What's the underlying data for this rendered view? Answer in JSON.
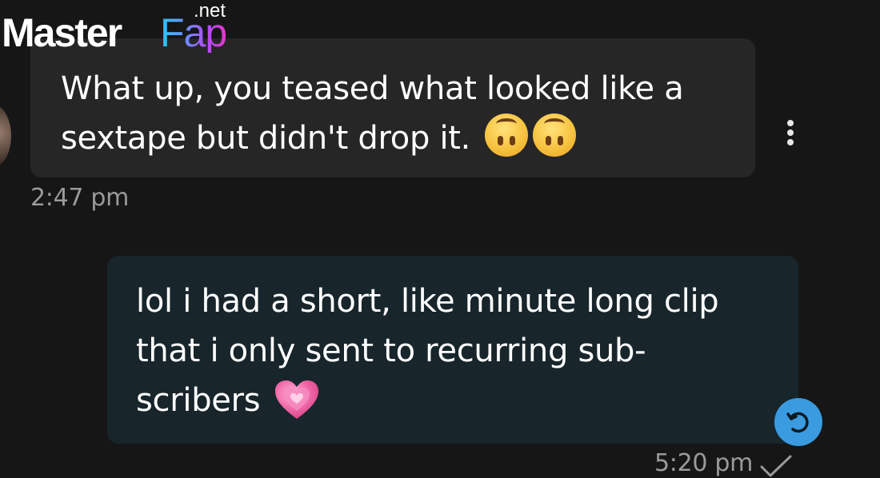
{
  "watermark": {
    "brand_master": "Master",
    "brand_fap": "Fap",
    "brand_tld": ".net"
  },
  "conversation": {
    "incoming": {
      "line1": "What up, you teased what looked like a",
      "line2": "sextape but didn't drop it.",
      "emojis": [
        "upside-down-face",
        "upside-down-face"
      ],
      "timestamp": "2:47 pm",
      "menu_icon": "more-vertical-icon"
    },
    "outgoing": {
      "line1": "lol i had a short, like minute long clip",
      "line2": "that i only sent to recurring sub-",
      "line3": "scribers",
      "emoji": "growing-heart",
      "timestamp": "5:20 pm",
      "status_icon": "check-icon",
      "action_icon": "undo-icon"
    }
  },
  "colors": {
    "background": "#161616",
    "incoming_bubble": "#262626",
    "outgoing_bubble": "#18262c",
    "accent_blue": "#3a9be0",
    "timestamp_gray": "#9a9a9a"
  }
}
